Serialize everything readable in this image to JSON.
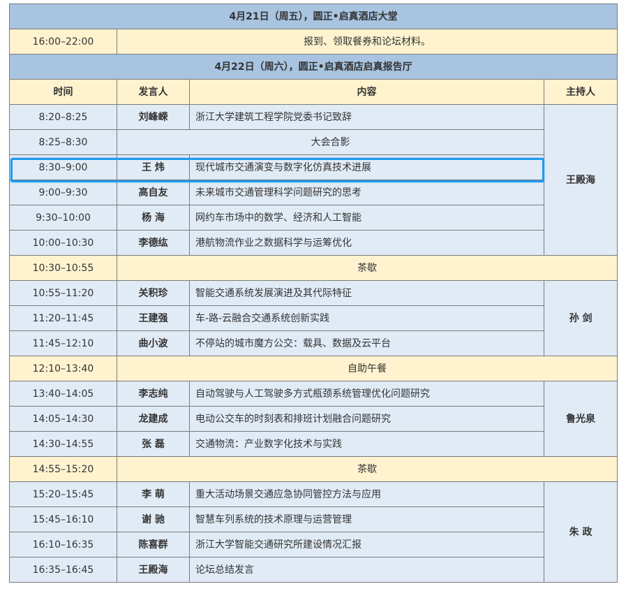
{
  "day1": {
    "banner": "4月21日（周五），圆正•启真酒店大堂",
    "rows": [
      {
        "time": "16:00–22:00",
        "content": "报到、领取餐券和论坛材料。"
      }
    ]
  },
  "day2": {
    "banner": "4月22日（周六），圆正•启真酒店启真报告厅",
    "headers": {
      "time": "时间",
      "speaker": "发言人",
      "content": "内容",
      "host": "主持人"
    },
    "hosts": [
      "王殿海",
      "孙  剑",
      "鲁光泉",
      "朱  政"
    ],
    "rows": [
      {
        "time": "8:20–8:25",
        "speaker": "刘峰嵘",
        "content": "浙江大学建筑工程学院党委书记致辞"
      },
      {
        "time": "8:25–8:30",
        "content": "大会合影"
      },
      {
        "time": "8:30–9:00",
        "speaker": "王  炜",
        "content": "现代城市交通演变与数字化仿真技术进展"
      },
      {
        "time": "9:00–9:30",
        "speaker": "高自友",
        "content": "未来城市交通管理科学问题研究的思考"
      },
      {
        "time": "9:30–10:00",
        "speaker": "杨  海",
        "content": "网约车市场中的数学、经济和人工智能"
      },
      {
        "time": "10:00–10:30",
        "speaker": "李德纮",
        "content": "港航物流作业之数据科学与运筹优化"
      },
      {
        "time": "10:30–10:55",
        "content": "茶歇"
      },
      {
        "time": "10:55–11:20",
        "speaker": "关积珍",
        "content": "智能交通系统发展演进及其代际特征"
      },
      {
        "time": "11:20–11:45",
        "speaker": "王建强",
        "content": "车-路-云融合交通系统创新实践"
      },
      {
        "time": "11:45–12:10",
        "speaker": "曲小波",
        "content": "不停站的城市魔方公交：载具、数据及云平台"
      },
      {
        "time": "12:10–13:40",
        "content": "自助午餐"
      },
      {
        "time": "13:40–14:05",
        "speaker": "李志纯",
        "content": "自动驾驶与人工驾驶多方式瓶颈系统管理优化问题研究"
      },
      {
        "time": "14:05–14:30",
        "speaker": "龙建成",
        "content": "电动公交车的时刻表和排班计划融合问题研究"
      },
      {
        "time": "14:30–14:55",
        "speaker": "张  磊",
        "content": "交通物流：产业数字化技术与实践"
      },
      {
        "time": "14:55–15:20",
        "content": "茶歇"
      },
      {
        "time": "15:20–15:45",
        "speaker": "李  萌",
        "content": "重大活动场景交通应急协同管控方法与应用"
      },
      {
        "time": "15:45–16:10",
        "speaker": "谢  驰",
        "content": "智慧车列系统的技术原理与运营管理"
      },
      {
        "time": "16:10–16:35",
        "speaker": "陈喜群",
        "content": "浙江大学智能交通研究所建设情况汇报"
      },
      {
        "time": "16:35–16:45",
        "speaker": "王殿海",
        "content": "论坛总结发言"
      }
    ]
  },
  "colors": {
    "banner": "#a8c4e0",
    "cream": "#fff3cf",
    "blue": "#e1ebf6",
    "highlight": "#1d9bf0"
  }
}
